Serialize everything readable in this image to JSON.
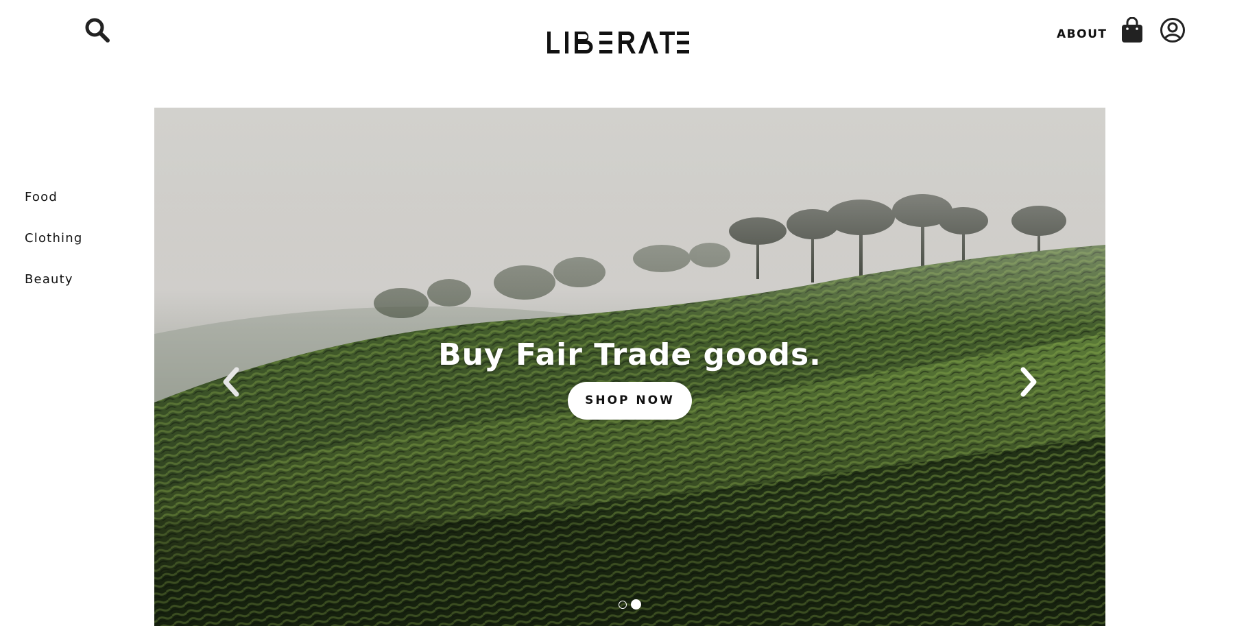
{
  "header": {
    "brand": "LIBERATE",
    "search_icon": "search-icon",
    "about_label": "ABOUT",
    "bag_icon": "shopping-bag-icon",
    "account_icon": "user-circle-icon"
  },
  "sidebar": {
    "items": [
      {
        "label": "Food"
      },
      {
        "label": "Clothing"
      },
      {
        "label": "Beauty"
      }
    ]
  },
  "hero": {
    "title": "Buy Fair Trade goods.",
    "cta_label": "SHOP NOW",
    "prev_icon": "chevron-left-icon",
    "next_icon": "chevron-right-icon",
    "slides_total": 2,
    "active_slide": 2
  },
  "colors": {
    "text": "#111111",
    "background": "#ffffff",
    "hero_overlay_text": "#ffffff"
  }
}
